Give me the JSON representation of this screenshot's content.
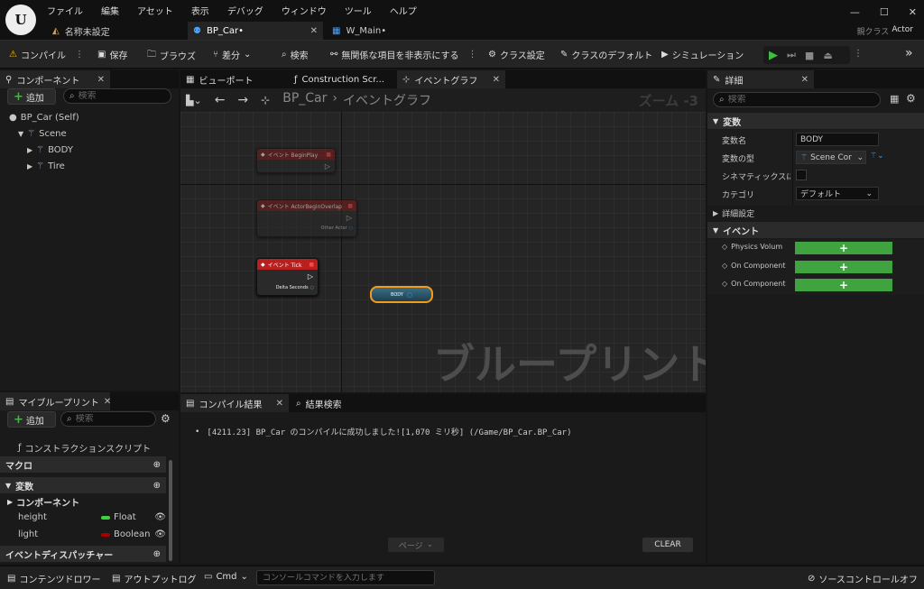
{
  "menu": [
    "ファイル",
    "編集",
    "アセット",
    "表示",
    "デバッグ",
    "ウィンドウ",
    "ツール",
    "ヘルプ"
  ],
  "doc_tabs": [
    {
      "label": "名称未設定"
    },
    {
      "label": "BP_Car•"
    },
    {
      "label": "W_Main•"
    }
  ],
  "parent_class": {
    "label": "親クラス",
    "value": "Actor"
  },
  "toolbar": {
    "compile": "コンパイル",
    "save": "保存",
    "browse": "ブラウズ",
    "diff": "差分",
    "find": "検索",
    "hide_unrelated": "無関係な項目を非表示にする",
    "class_settings": "クラス設定",
    "class_defaults": "クラスのデフォルト",
    "simulation": "シミュレーション"
  },
  "components": {
    "tab": "コンポーネント",
    "add": "追加",
    "search_placeholder": "検索",
    "tree": [
      {
        "label": "BP_Car (Self)"
      },
      {
        "label": "Scene"
      },
      {
        "label": "BODY"
      },
      {
        "label": "Tire"
      }
    ]
  },
  "graph_tabs": {
    "viewport": "ビューポート",
    "construction": "Construction Scr...",
    "event_graph": "イベントグラフ"
  },
  "graph": {
    "breadcrumb_root": "BP_Car",
    "breadcrumb_leaf": "イベントグラフ",
    "zoom": "ズーム -3",
    "watermark": "ブループリント",
    "nodes": {
      "begin_play": "イベント BeginPlay",
      "overlap": "イベント ActorBeginOverlap",
      "overlap_pin": "Other Actor",
      "tick": "イベント Tick",
      "tick_pin": "Delta Seconds",
      "body": "BODY"
    }
  },
  "my_blueprint": {
    "tab": "マイブループリント",
    "add": "追加",
    "search_placeholder": "検索",
    "construction_script": "コンストラクションスクリプト",
    "macro": "マクロ",
    "variables": "変数",
    "components": "コンポーネント",
    "vars": [
      {
        "name": "height",
        "type": "Float"
      },
      {
        "name": "light",
        "type": "Boolean"
      }
    ],
    "dispatchers": "イベントディスパッチャー"
  },
  "output": {
    "tab_compile": "コンパイル結果",
    "tab_search": "結果検索",
    "message": "[4211.23] BP_Car のコンパイルに成功しました![1,070 ミリ秒] (/Game/BP_Car.BP_Car)",
    "page": "ページ",
    "clear": "CLEAR"
  },
  "details": {
    "tab": "詳細",
    "search_placeholder": "検索",
    "section_vars": "変数",
    "var_name_label": "変数名",
    "var_name_value": "BODY",
    "var_type_label": "変数の型",
    "var_type_value": "Scene Cor",
    "cinematic_label": "シネマティックスに公開",
    "category_label": "カテゴリ",
    "category_value": "デフォルト",
    "advanced": "詳細設定",
    "section_events": "イベント",
    "events": [
      "Physics Volum",
      "On Component",
      "On Component"
    ]
  },
  "statusbar": {
    "content_drawer": "コンテンツドロワー",
    "output_log": "アウトプットログ",
    "cmd": "Cmd",
    "console_placeholder": "コンソールコマンドを入力します",
    "source_control": "ソースコントロールオフ"
  }
}
